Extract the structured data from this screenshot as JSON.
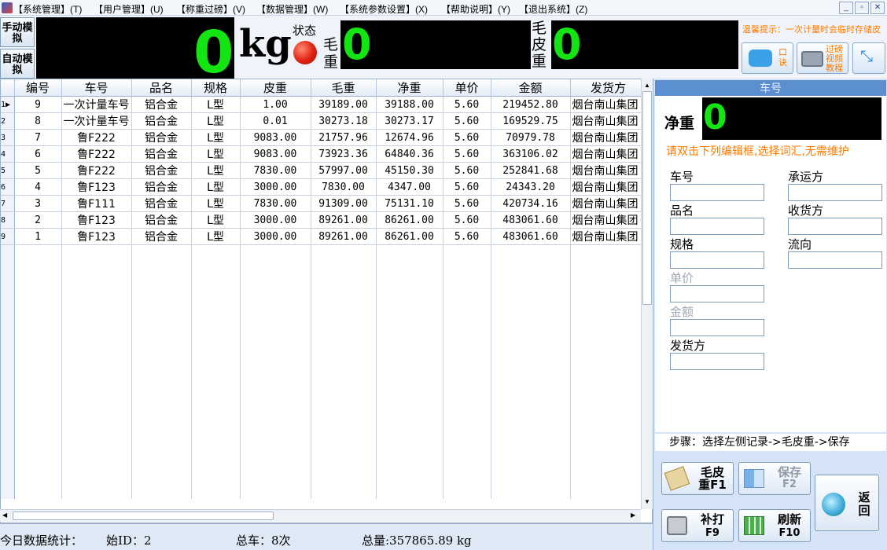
{
  "menu": [
    "【系统管理】(T)",
    "【用户管理】(U)",
    "【称重过磅】(V)",
    "【数据管理】(W)",
    "【系统参数设置】(X)",
    "【帮助说明】(Y)",
    "【退出系统】(Z)"
  ],
  "window_controls": [
    "_",
    "▫",
    "✕"
  ],
  "top": {
    "manual_sim": "手动模拟",
    "auto_sim": "自动模拟",
    "weight_value": "0",
    "unit": "kg",
    "status_label": "状态",
    "gross_label": "毛重",
    "gross_value": "0",
    "tare_label": "毛皮重",
    "tare_value": "0",
    "tip": "温馨提示：一次计量时会临时存储皮",
    "btn_mouth": "口诀",
    "btn_video": "过磅视频教程",
    "status_color": "#e02010",
    "digit_color": "#12e512"
  },
  "table": {
    "headers": [
      "编号",
      "车号",
      "品名",
      "规格",
      "皮重",
      "毛重",
      "净重",
      "单价",
      "金额",
      "发货方"
    ],
    "rows": [
      [
        "9",
        "一次计量车号",
        "铝合金",
        "L型",
        "1.00",
        "39189.00",
        "39188.00",
        "5.60",
        "219452.80",
        "烟台南山集团"
      ],
      [
        "8",
        "一次计量车号",
        "铝合金",
        "L型",
        "0.01",
        "30273.18",
        "30273.17",
        "5.60",
        "169529.75",
        "烟台南山集团"
      ],
      [
        "7",
        "鲁F222",
        "铝合金",
        "L型",
        "9083.00",
        "21757.96",
        "12674.96",
        "5.60",
        "70979.78",
        "烟台南山集团"
      ],
      [
        "6",
        "鲁F222",
        "铝合金",
        "L型",
        "9083.00",
        "73923.36",
        "64840.36",
        "5.60",
        "363106.02",
        "烟台南山集团"
      ],
      [
        "5",
        "鲁F222",
        "铝合金",
        "L型",
        "7830.00",
        "57997.00",
        "45150.30",
        "5.60",
        "252841.68",
        "烟台南山集团"
      ],
      [
        "4",
        "鲁F123",
        "铝合金",
        "L型",
        "3000.00",
        "7830.00",
        "4347.00",
        "5.60",
        "24343.20",
        "烟台南山集团"
      ],
      [
        "3",
        "鲁F111",
        "铝合金",
        "L型",
        "7830.00",
        "91309.00",
        "75131.10",
        "5.60",
        "420734.16",
        "烟台南山集团"
      ],
      [
        "2",
        "鲁F123",
        "铝合金",
        "L型",
        "3000.00",
        "89261.00",
        "86261.00",
        "5.60",
        "483061.60",
        "烟台南山集团"
      ],
      [
        "1",
        "鲁F123",
        "铝合金",
        "L型",
        "3000.00",
        "89261.00",
        "86261.00",
        "5.60",
        "483061.60",
        "烟台南山集团"
      ]
    ],
    "row_markers": [
      "1▶",
      "2",
      "3",
      "4",
      "5",
      "6",
      "7",
      "8",
      "9"
    ]
  },
  "status": {
    "today": "今日数据统计：",
    "start_id": "始ID：2",
    "total_cars": "总车：8次",
    "total_weight": "总量:357865.89 kg"
  },
  "right": {
    "header": "车号",
    "net_label": "净重",
    "net_value": "0",
    "hint": "请双击下列编辑框,选择词汇,无需维护",
    "fields_left": [
      "车号",
      "品名",
      "规格",
      "单价",
      "金额",
      "发货方"
    ],
    "fields_right": [
      "承运方",
      "收货方",
      "流向"
    ],
    "steps": "步骤：选择左侧记录->毛皮重->保存",
    "btn_weigh": "毛皮重F1",
    "btn_save": "保存",
    "btn_save_key": "F2",
    "btn_back": "返回",
    "btn_print": "补打",
    "btn_print_key": "F9",
    "btn_refresh": "刷新",
    "btn_refresh_key": "F10",
    "hint_color": "#ff7a00"
  }
}
